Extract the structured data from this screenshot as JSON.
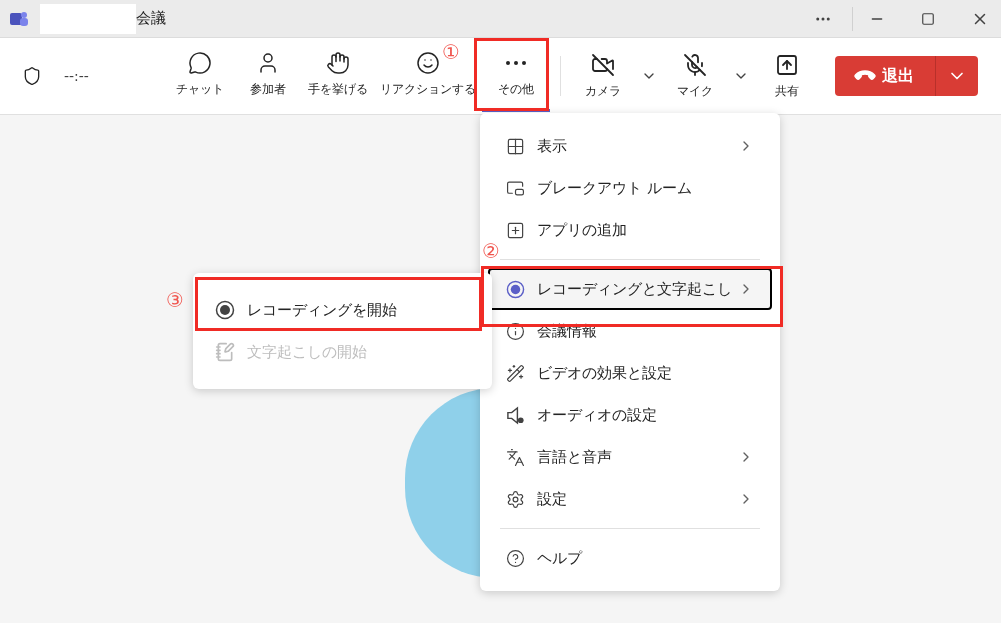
{
  "window": {
    "title": "会議"
  },
  "toolbar": {
    "timer": "--:--",
    "buttons": [
      {
        "label": "チャット",
        "selected": false
      },
      {
        "label": "参加者",
        "selected": false
      },
      {
        "label": "手を挙げる",
        "selected": false
      },
      {
        "label": "リアクションする",
        "selected": false
      },
      {
        "label": "その他",
        "selected": true
      }
    ],
    "devices": [
      {
        "label": "カメラ"
      },
      {
        "label": "マイク"
      },
      {
        "label": "共有"
      }
    ],
    "leave": {
      "label": "退出"
    }
  },
  "menu": {
    "items": [
      {
        "label": "表示",
        "submenu": true,
        "selected": false
      },
      {
        "label": "ブレークアウト ルーム",
        "submenu": false,
        "selected": false
      },
      {
        "label": "アプリの追加",
        "submenu": false,
        "selected": false
      },
      {
        "label": "レコーディングと文字起こし",
        "submenu": true,
        "selected": true
      },
      {
        "label": "会議情報",
        "submenu": false,
        "selected": false
      },
      {
        "label": "ビデオの効果と設定",
        "submenu": false,
        "selected": false
      },
      {
        "label": "オーディオの設定",
        "submenu": false,
        "selected": false
      },
      {
        "label": "言語と音声",
        "submenu": true,
        "selected": false
      },
      {
        "label": "設定",
        "submenu": true,
        "selected": false
      },
      {
        "label": "ヘルプ",
        "submenu": false,
        "selected": false
      }
    ]
  },
  "submenu": {
    "items": [
      {
        "label": "レコーディングを開始",
        "disabled": false
      },
      {
        "label": "文字起こしの開始",
        "disabled": true
      }
    ]
  },
  "annotations": [
    {
      "label": "①"
    },
    {
      "label": "②"
    },
    {
      "label": "③"
    }
  ]
}
